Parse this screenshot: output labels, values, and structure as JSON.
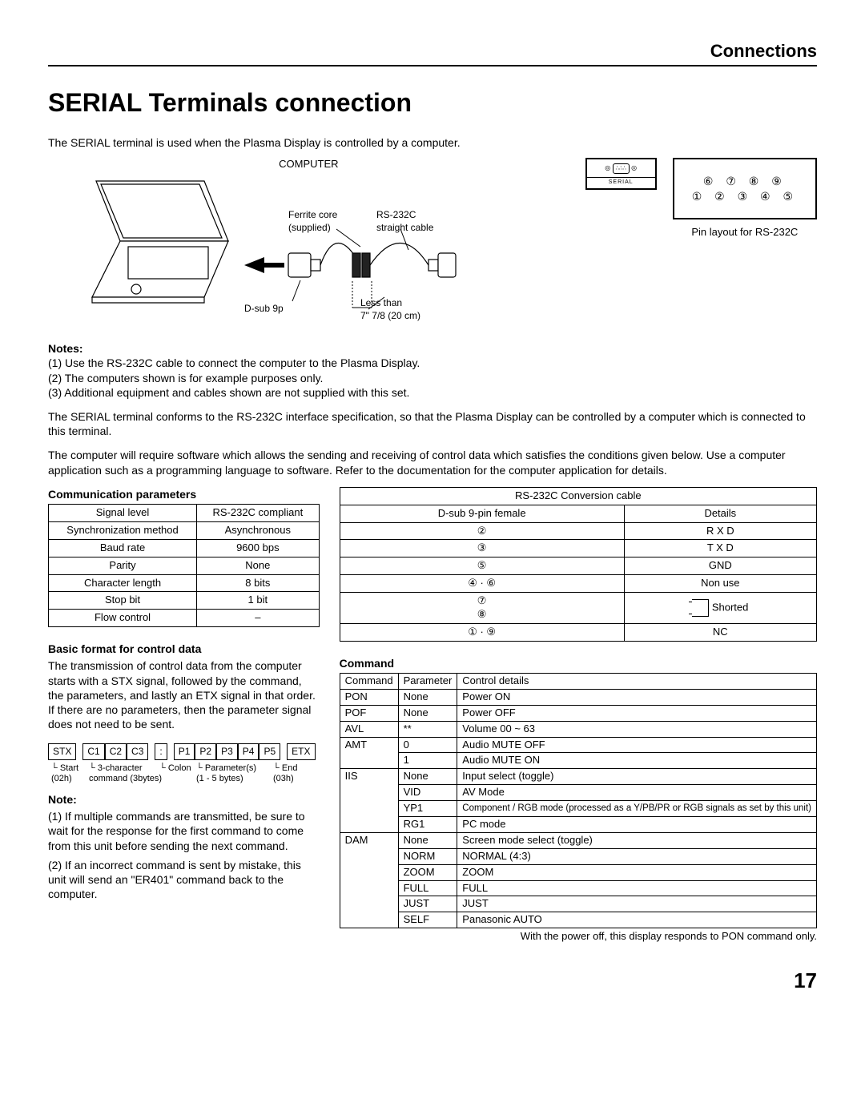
{
  "header": {
    "section": "Connections"
  },
  "title": "SERIAL Terminals connection",
  "intro": "The SERIAL terminal is used when the Plasma Display is controlled by a computer.",
  "diagram": {
    "computer": "COMPUTER",
    "ferrite": "Ferrite core\n(supplied)",
    "rs232c": "RS-232C\nstraight cable",
    "dsub": "D-sub 9p",
    "lessthan": "Less than\n7\" 7/8 (20 cm)",
    "serial": "SERIAL",
    "pin_row1": "⑥ ⑦ ⑧ ⑨",
    "pin_row2": "① ② ③ ④ ⑤",
    "pin_caption": "Pin layout for RS-232C"
  },
  "notes1": {
    "title": "Notes:",
    "items": [
      "(1) Use the RS-232C cable to connect the computer to the Plasma Display.",
      "(2) The computers shown is for example purposes only.",
      "(3) Additional equipment and cables shown are not supplied with this set."
    ]
  },
  "para1": "The SERIAL terminal conforms to the RS-232C interface specification, so that the Plasma Display can be controlled by a computer which is connected to this terminal.",
  "para2": "The computer will require software which allows the sending and receiving of control data which satisfies the conditions given below. Use a computer application such as a programming language to software. Refer to the documentation for the computer application for details.",
  "comm": {
    "title": "Communication parameters",
    "rows": [
      [
        "Signal level",
        "RS-232C compliant"
      ],
      [
        "Synchronization method",
        "Asynchronous"
      ],
      [
        "Baud rate",
        "9600 bps"
      ],
      [
        "Parity",
        "None"
      ],
      [
        "Character length",
        "8 bits"
      ],
      [
        "Stop bit",
        "1 bit"
      ],
      [
        "Flow control",
        "–"
      ]
    ]
  },
  "conv": {
    "title": "RS-232C Conversion cable",
    "header": [
      "D-sub 9-pin female",
      "Details"
    ],
    "rows": [
      [
        "②",
        "R X D"
      ],
      [
        "③",
        "T X D"
      ],
      [
        "⑤",
        "GND"
      ],
      [
        "④ · ⑥",
        "Non use"
      ],
      [
        "⑦\n⑧",
        "Shorted"
      ],
      [
        "① · ⑨",
        "NC"
      ]
    ]
  },
  "format": {
    "title": "Basic format for control data",
    "text": "The transmission of control data from the computer starts with a STX signal, followed by the command, the parameters, and lastly an ETX signal in that order. If there are no parameters, then the parameter signal does not need to be sent.",
    "stx": "STX",
    "c1": "C1",
    "c2": "C2",
    "c3": "C3",
    "colon": ":",
    "p1": "P1",
    "p2": "P2",
    "p3": "P3",
    "p4": "P4",
    "p5": "P5",
    "etx": "ETX",
    "lbl_start": "Start\n(02h)",
    "lbl_cmd": "3-character\ncommand (3bytes)",
    "lbl_colon": "Colon",
    "lbl_params": "Parameter(s)\n(1 - 5 bytes)",
    "lbl_end": "End\n(03h)"
  },
  "note2": {
    "title": "Note:",
    "items": [
      "(1) If multiple commands are transmitted, be sure to wait for the response for the first command to come from this unit before sending the next command.",
      "(2) If an incorrect command is sent by mistake, this unit will send an \"ER401\" command back to the computer."
    ]
  },
  "cmd": {
    "title": "Command",
    "header": [
      "Command",
      "Parameter",
      "Control details"
    ],
    "rows": [
      [
        "PON",
        "None",
        "Power ON"
      ],
      [
        "POF",
        "None",
        "Power OFF"
      ],
      [
        "AVL",
        "**",
        "Volume 00 ~ 63"
      ],
      [
        "AMT",
        "0",
        "Audio MUTE OFF"
      ],
      [
        "",
        "1",
        "Audio MUTE ON"
      ],
      [
        "IIS",
        "None",
        "Input select (toggle)"
      ],
      [
        "",
        "VID",
        "AV Mode"
      ],
      [
        "",
        "YP1",
        "Component / RGB mode (processed as a Y/PB/PR or RGB signals as set by this unit)"
      ],
      [
        "",
        "RG1",
        "PC mode"
      ],
      [
        "DAM",
        "None",
        "Screen mode select (toggle)"
      ],
      [
        "",
        "NORM",
        "NORMAL (4:3)"
      ],
      [
        "",
        "ZOOM",
        "ZOOM"
      ],
      [
        "",
        "FULL",
        "FULL"
      ],
      [
        "",
        "JUST",
        "JUST"
      ],
      [
        "",
        "SELF",
        "Panasonic AUTO"
      ]
    ],
    "footer": "With the power off, this display responds to PON command only."
  },
  "page": "17"
}
